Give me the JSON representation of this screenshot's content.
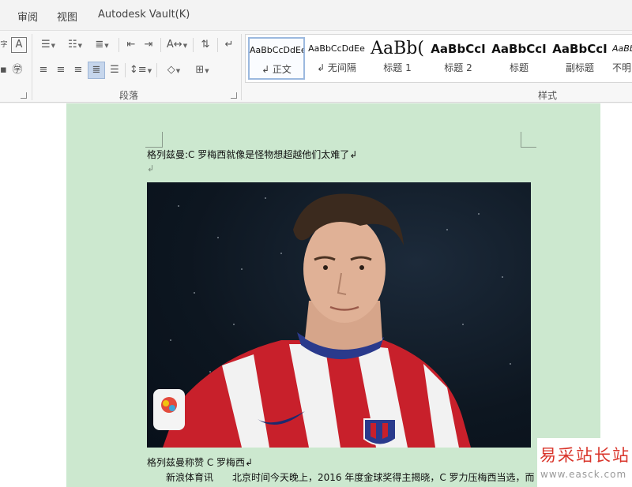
{
  "tabs": [
    {
      "label": "审阅"
    },
    {
      "label": "视图"
    },
    {
      "label": "Autodesk Vault(K)"
    }
  ],
  "ribbon": {
    "groups": {
      "paragraph": "段落",
      "styles": "样式"
    },
    "styles": [
      {
        "sample": "AaBbCcDdEe",
        "name": "↲ 正文"
      },
      {
        "sample": "AaBbCcDdEe",
        "name": "↲ 无间隔"
      },
      {
        "sample": "AaBb(",
        "name": "标题 1"
      },
      {
        "sample": "AaBbCcI",
        "name": "标题 2"
      },
      {
        "sample": "AaBbCcI",
        "name": "标题"
      },
      {
        "sample": "AaBbCcI",
        "name": "副标题"
      },
      {
        "sample": "AaBb",
        "name": "不明"
      }
    ]
  },
  "document": {
    "title_line": "格列兹曼:C 罗梅西就像是怪物想超越他们太难了↲",
    "empty_mark": "↲",
    "caption": "格列兹曼称赞 C 罗梅西↲",
    "body_line": "新浪体育讯　　北京时间今天晚上，2016 年度金球奖得主揭晓，C 罗力压梅西当选，而"
  },
  "watermark": {
    "name": "易采站长站",
    "url": "www.easck.com"
  },
  "colors": {
    "page_bg": "#cce8cf",
    "accent": "#9cb9df",
    "watermark_red": "#d9352b"
  }
}
